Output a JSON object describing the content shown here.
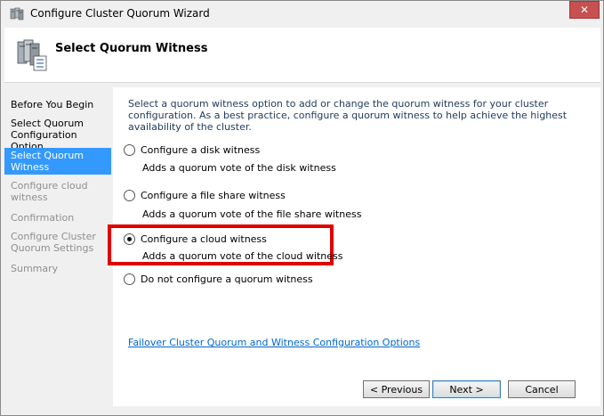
{
  "window": {
    "title": "Configure Cluster Quorum Wizard",
    "close_label": "✕"
  },
  "header": {
    "title": "Select Quorum Witness"
  },
  "nav": {
    "items": [
      {
        "label": "Before You Begin",
        "state": "normal"
      },
      {
        "label": "Select Quorum Configuration Option",
        "state": "normal"
      },
      {
        "label": "Select Quorum Witness",
        "state": "selected"
      },
      {
        "label": "Configure cloud witness",
        "state": "disabled"
      },
      {
        "label": "Confirmation",
        "state": "disabled"
      },
      {
        "label": "Configure Cluster Quorum Settings",
        "state": "disabled"
      },
      {
        "label": "Summary",
        "state": "disabled"
      }
    ]
  },
  "main": {
    "intro": "Select a quorum witness option to add or change the quorum witness for your cluster configuration. As a best practice, configure a quorum witness to help achieve the highest availability of the cluster.",
    "options": [
      {
        "label": "Configure a disk witness",
        "description": "Adds a quorum vote of the disk witness",
        "checked": false
      },
      {
        "label": "Configure a file share witness",
        "description": "Adds a quorum vote of the file share witness",
        "checked": false
      },
      {
        "label": "Configure a cloud witness",
        "description": "Adds a quorum vote of the cloud witness",
        "checked": true
      },
      {
        "label": "Do not configure a quorum witness",
        "description": "",
        "checked": false
      }
    ],
    "help_link": "Failover Cluster Quorum and Witness Configuration Options"
  },
  "buttons": {
    "previous": "< Previous",
    "next": "Next >",
    "cancel": "Cancel"
  },
  "colors": {
    "selected_nav": "#3399ff",
    "highlight_box": "#e00000",
    "link": "#0066cc",
    "close_button": "#c75050"
  },
  "icons": {
    "title": "cluster-wizard-icon",
    "header": "cluster-servers-icon"
  }
}
